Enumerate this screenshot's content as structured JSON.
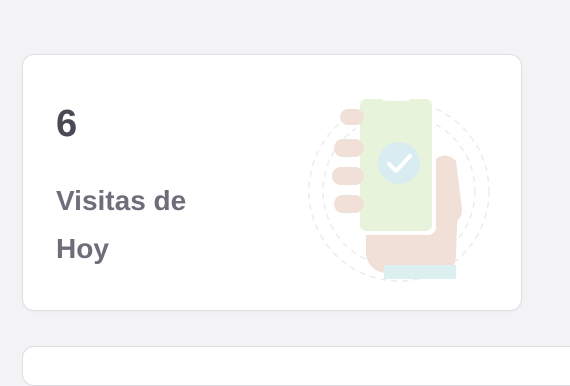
{
  "stat_card": {
    "value": "6",
    "label": "Visitas de Hoy",
    "illustration_icon": "phone-check-icon"
  },
  "colors": {
    "background": "#f3f3f5",
    "card": "#ffffff",
    "value_text": "#4a4a55",
    "label_text": "#6e6e7a",
    "phone_screen": "#e8f3dc",
    "check_badge": "#d9ecf2",
    "hand": "#f1e0d7"
  }
}
